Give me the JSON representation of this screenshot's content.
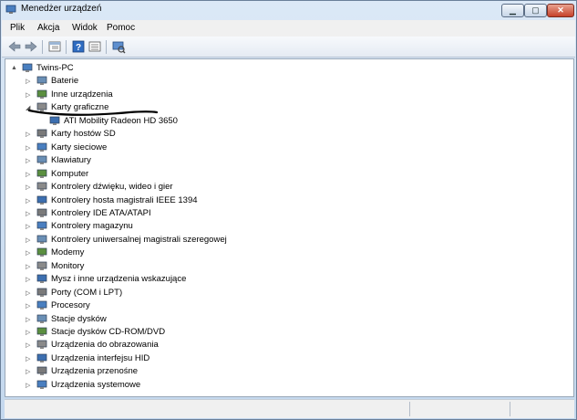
{
  "window": {
    "title": "Menedżer urządzeń"
  },
  "menu": [
    "Plik",
    "Akcja",
    "Widok",
    "Pomoc"
  ],
  "tree": {
    "root": "Twins-PC",
    "categories": [
      "Baterie",
      "Inne urządzenia",
      "Karty graficzne",
      "Karty hostów SD",
      "Karty sieciowe",
      "Klawiatury",
      "Komputer",
      "Kontrolery dźwięku, wideo i gier",
      "Kontrolery hosta magistrali IEEE 1394",
      "Kontrolery IDE ATA/ATAPI",
      "Kontrolery magazynu",
      "Kontrolery uniwersalnej magistrali szeregowej",
      "Modemy",
      "Monitory",
      "Mysz i inne urządzenia wskazujące",
      "Porty (COM i LPT)",
      "Procesory",
      "Stacje dysków",
      "Stacje dysków CD-ROM/DVD",
      "Urządzenia do obrazowania",
      "Urządzenia interfejsu HID",
      "Urządzenia przenośne",
      "Urządzenia systemowe"
    ],
    "expanded_child": "ATI Mobility Radeon HD 3650"
  },
  "colors": {
    "accent": "#2a5ea8",
    "underline": "#000000"
  }
}
